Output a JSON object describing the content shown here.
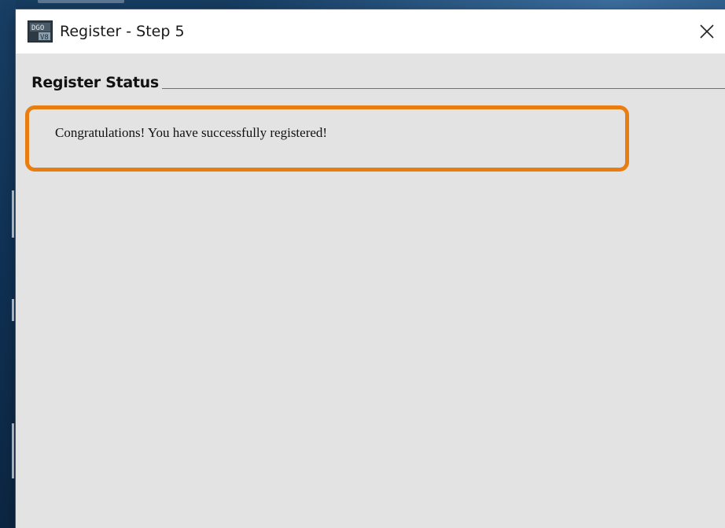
{
  "window": {
    "title": "Register - Step 5",
    "icon": "app-logo-icon",
    "close_icon": "close-icon"
  },
  "section": {
    "title": "Register Status"
  },
  "status": {
    "message": "Congratulations! You have successfully registered!"
  },
  "annotation": {
    "highlight_color": "#e87d12"
  },
  "colors": {
    "dialog_background": "#e3e3e3",
    "titlebar_background": "#ffffff",
    "desktop_background": "#0e2c49"
  }
}
